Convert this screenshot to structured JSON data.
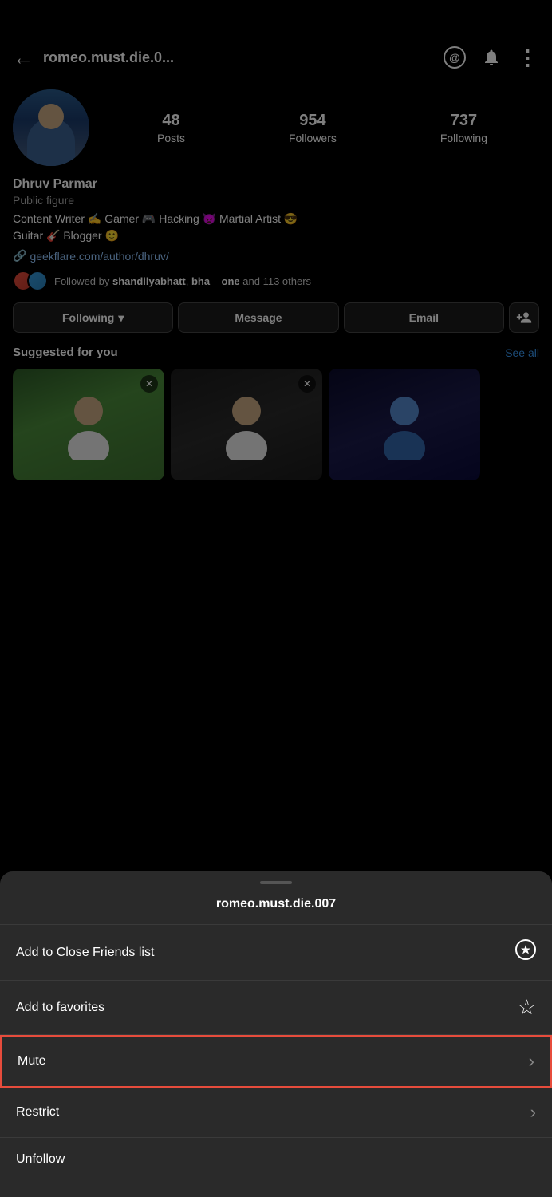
{
  "statusBar": {
    "height": 44
  },
  "topNav": {
    "backLabel": "←",
    "username": "romeo.must.die.0...",
    "threadsIcon": "@",
    "notificationIcon": "🔔",
    "moreIcon": "⋮"
  },
  "profile": {
    "name": "Dhruv Parmar",
    "category": "Public figure",
    "bio": "Content Writer ✍️ Gamer 🎮 Hacking 👿 Martial Artist 😎\nGuitar 🎸 Blogger 🙂",
    "link": "geekflare.com/author/dhruv/",
    "stats": {
      "posts": {
        "count": "48",
        "label": "Posts"
      },
      "followers": {
        "count": "954",
        "label": "Followers"
      },
      "following": {
        "count": "737",
        "label": "Following"
      }
    },
    "followedBy": "Followed by shandilyabhatt, bha__one and 113 others"
  },
  "actionButtons": {
    "following": "Following",
    "message": "Message",
    "email": "Email",
    "addFriend": "+"
  },
  "suggested": {
    "title": "Suggested for you",
    "seeAll": "See all"
  },
  "bottomSheet": {
    "username": "romeo.must.die.007",
    "items": [
      {
        "label": "Add to Close Friends list",
        "icon": "★",
        "iconType": "star-filled",
        "hasChevron": false
      },
      {
        "label": "Add to favorites",
        "icon": "☆",
        "iconType": "star-outline",
        "hasChevron": false
      },
      {
        "label": "Mute",
        "icon": "›",
        "iconType": "chevron",
        "hasChevron": true,
        "highlighted": true
      },
      {
        "label": "Restrict",
        "icon": "›",
        "iconType": "chevron",
        "hasChevron": true
      },
      {
        "label": "Unfollow",
        "icon": "",
        "iconType": "none",
        "hasChevron": false,
        "isLast": true
      }
    ]
  }
}
